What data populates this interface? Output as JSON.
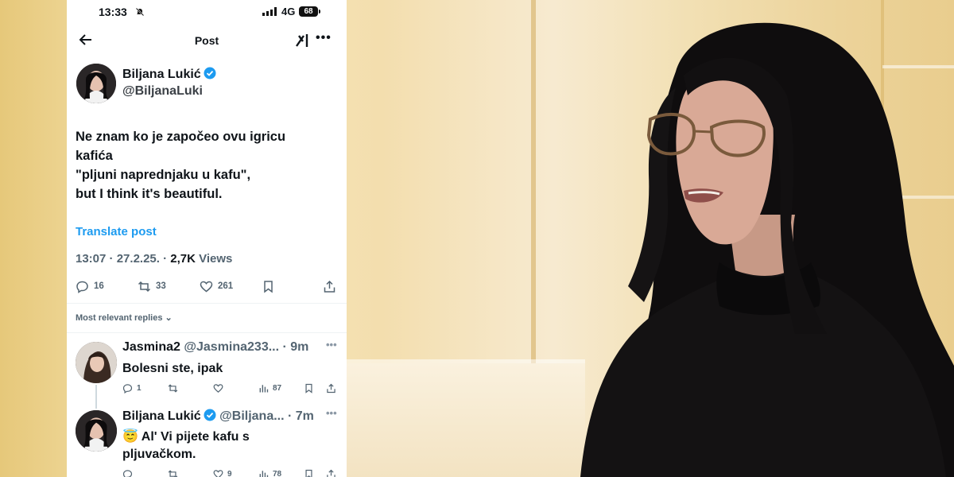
{
  "status_bar": {
    "time": "13:33",
    "network": "4G",
    "battery": "68"
  },
  "nav": {
    "title": "Post"
  },
  "post": {
    "author_name": "Biljana Lukić",
    "author_handle": "@BiljanaLuki",
    "text_lines": [
      "Ne znam ko je započeo ovu igricu",
      "kafića",
      "\"pljuni naprednjaku u kafu\",",
      "but I think it's beautiful."
    ],
    "translate_label": "Translate post",
    "time": "13:07",
    "date": "27.2.25.",
    "views_count": "2,7K",
    "views_label": "Views",
    "replies": "16",
    "reposts": "33",
    "likes": "261"
  },
  "replies_filter": "Most relevant replies",
  "replies": [
    {
      "name": "Jasmina2",
      "handle": "@Jasmina233...",
      "time": "9m",
      "text": "Bolesni ste, ipak",
      "replies": "1",
      "reposts": "",
      "likes": "",
      "views": "87"
    },
    {
      "name": "Biljana Lukić",
      "handle": "@Biljana...",
      "time": "7m",
      "emoji": "😇",
      "text_line1": "Al' Vi pijete kafu s",
      "text_line2": "pljuvačkom.",
      "replies": "",
      "reposts": "",
      "likes": "9",
      "views": "78"
    }
  ],
  "colors": {
    "accent": "#1d9bf0",
    "text": "#0f1419",
    "muted": "#536471"
  },
  "icons": [
    "back-arrow-icon",
    "grok-icon",
    "more-icon",
    "verified-badge-icon",
    "reply-icon",
    "repost-icon",
    "like-icon",
    "bookmark-icon",
    "share-icon",
    "views-icon",
    "bell-off-icon",
    "signal-icon"
  ]
}
